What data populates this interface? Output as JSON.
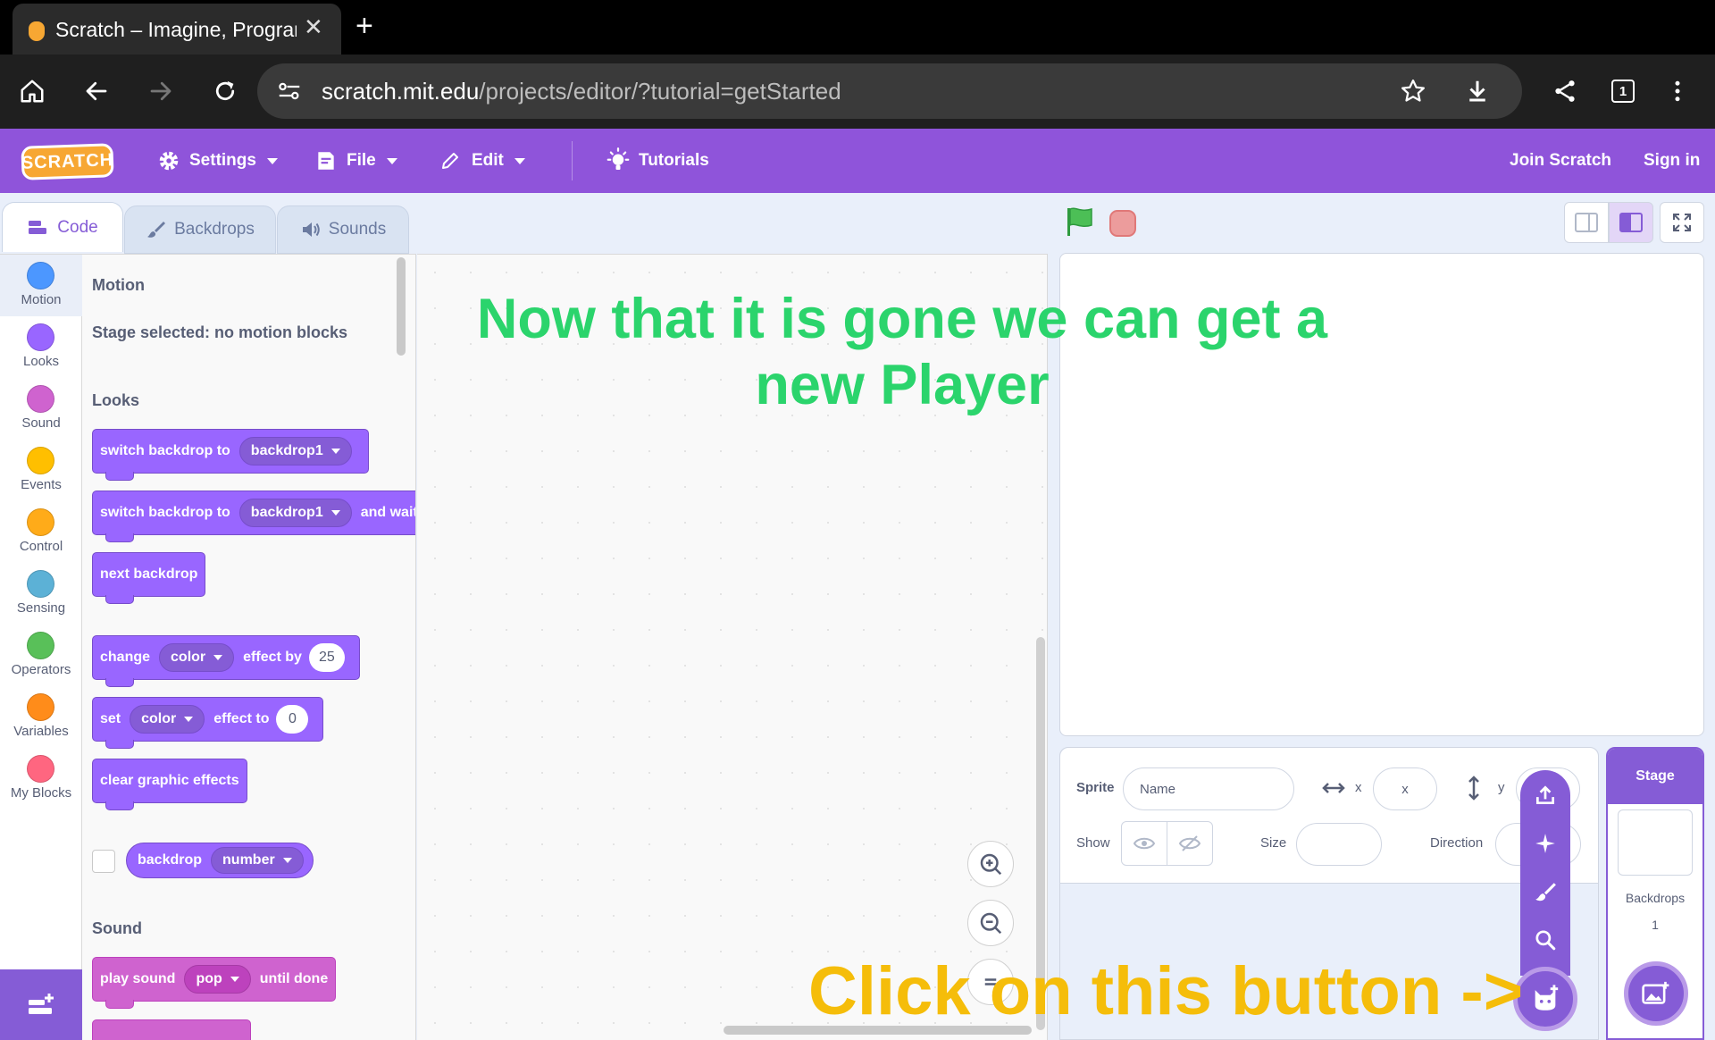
{
  "browser": {
    "tab_title": "Scratch – Imagine, Program, Create",
    "url_host": "scratch.mit.edu",
    "url_path": "/projects/editor/?tutorial=getStarted",
    "tab_count": "1"
  },
  "menubar": {
    "logo": "SCRATCH",
    "settings": "Settings",
    "file": "File",
    "edit": "Edit",
    "tutorials": "Tutorials",
    "join": "Join Scratch",
    "signin": "Sign in"
  },
  "editor_tabs": {
    "code": "Code",
    "backdrops": "Backdrops",
    "sounds": "Sounds"
  },
  "categories": [
    {
      "label": "Motion",
      "color": "#4c97ff"
    },
    {
      "label": "Looks",
      "color": "#9966ff"
    },
    {
      "label": "Sound",
      "color": "#cf63cf"
    },
    {
      "label": "Events",
      "color": "#ffbf00"
    },
    {
      "label": "Control",
      "color": "#ffab19"
    },
    {
      "label": "Sensing",
      "color": "#5cb1d6"
    },
    {
      "label": "Operators",
      "color": "#59c059"
    },
    {
      "label": "Variables",
      "color": "#ff8c1a"
    },
    {
      "label": "My Blocks",
      "color": "#ff6680"
    }
  ],
  "palette": {
    "motion_title": "Motion",
    "motion_note": "Stage selected: no motion blocks",
    "looks_title": "Looks",
    "switch1_text": "switch backdrop to",
    "switch1_value": "backdrop1",
    "switch2_text": "switch backdrop to",
    "switch2_value": "backdrop1",
    "switch2_suffix": "and wait",
    "next_backdrop": "next backdrop",
    "change_text": "change",
    "change_effect": "color",
    "change_mid": "effect by",
    "change_value": "25",
    "set_text": "set",
    "set_effect": "color",
    "set_mid": "effect to",
    "set_value": "0",
    "clear_effects": "clear graphic effects",
    "backdrop_reporter": "backdrop",
    "backdrop_reporter_value": "number",
    "sound_title": "Sound",
    "play_sound_text": "play sound",
    "play_sound_value": "pop",
    "play_sound_suffix": "until done"
  },
  "sprite_info": {
    "sprite_label": "Sprite",
    "name_placeholder": "Name",
    "x_label": "x",
    "x_placeholder": "x",
    "y_label": "y",
    "show_label": "Show",
    "size_label": "Size",
    "direction_label": "Direction"
  },
  "stage_pane": {
    "header": "Stage",
    "backdrops_label": "Backdrops",
    "backdrops_count": "1"
  },
  "overlays": {
    "green_text": "Now that it is gone we can get a new Player",
    "yellow_text": "Click on this button ->"
  },
  "colors": {
    "scratch_purple": "#855cd6",
    "menubar": "#8f54da",
    "looks_block": "#9966ff",
    "sound_block": "#cf63cf",
    "overlay_green": "#2bd46c",
    "overlay_yellow": "#f5bd0a"
  }
}
